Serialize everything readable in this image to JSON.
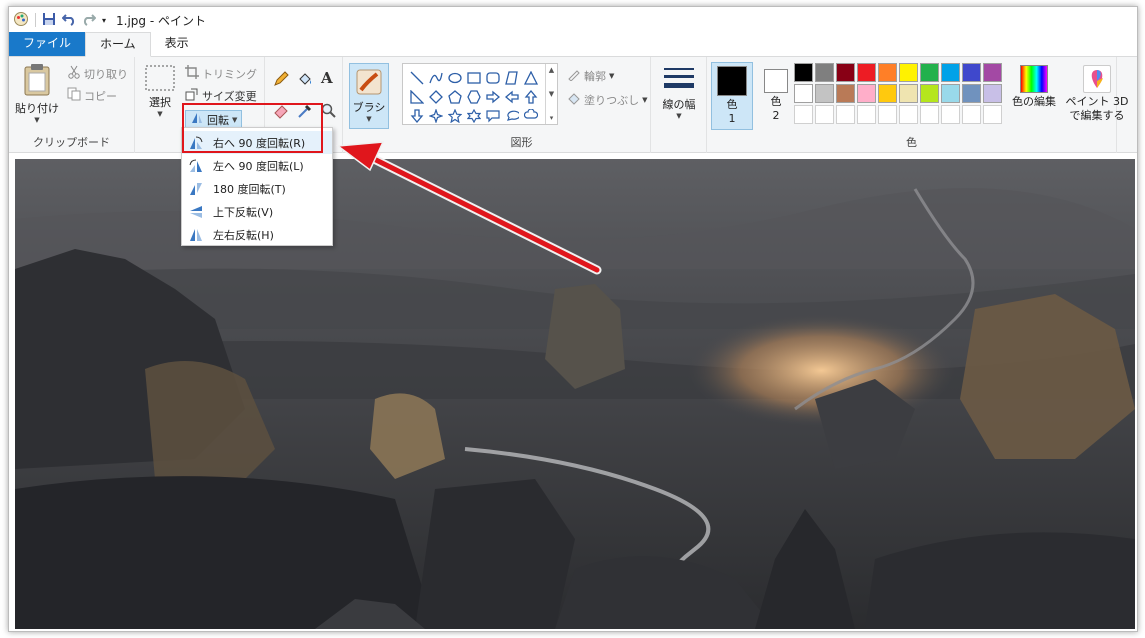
{
  "window": {
    "title": "1.jpg - ペイント"
  },
  "tabs": [
    {
      "label": "ファイル"
    },
    {
      "label": "ホーム"
    },
    {
      "label": "表示"
    }
  ],
  "clipboard": {
    "paste": "貼り付け",
    "cut": "切り取り",
    "copy": "コピー",
    "group": "クリップボード"
  },
  "image": {
    "select": "選択",
    "crop": "トリミング",
    "resize": "サイズ変更",
    "rotate": "回転"
  },
  "tools": {
    "brush": "ブラシ"
  },
  "shapes": {
    "outline": "輪郭",
    "fill": "塗りつぶし",
    "group": "図形"
  },
  "size": {
    "label": "線の幅"
  },
  "colors": {
    "color1_label": "色",
    "color1_num": "1",
    "color2_label": "色",
    "color2_num": "2",
    "edit": "色の編集",
    "group": "色",
    "row1": [
      "#000000",
      "#7f7f7f",
      "#880015",
      "#ed1c24",
      "#ff7f27",
      "#fff200",
      "#22b14c",
      "#00a2e8",
      "#3f48cc",
      "#a349a4"
    ],
    "row2": [
      "#ffffff",
      "#c3c3c3",
      "#b97a57",
      "#ffaec9",
      "#ffc90e",
      "#efe4b0",
      "#b5e61d",
      "#99d9ea",
      "#7092be",
      "#c8bfe7"
    ]
  },
  "paint3d": {
    "label": "ペイント 3D で編集する"
  },
  "rotate_menu": [
    {
      "label": "右へ 90 度回転(R)",
      "icon": "rotate-right-icon"
    },
    {
      "label": "左へ 90 度回転(L)",
      "icon": "rotate-left-icon"
    },
    {
      "label": "180 度回転(T)",
      "icon": "rotate-180-icon"
    },
    {
      "label": "上下反転(V)",
      "icon": "flip-vertical-icon"
    },
    {
      "label": "左右反転(H)",
      "icon": "flip-horizontal-icon"
    }
  ],
  "accent": {
    "highlight": "#e0161c",
    "file_tab": "#1979ca"
  }
}
